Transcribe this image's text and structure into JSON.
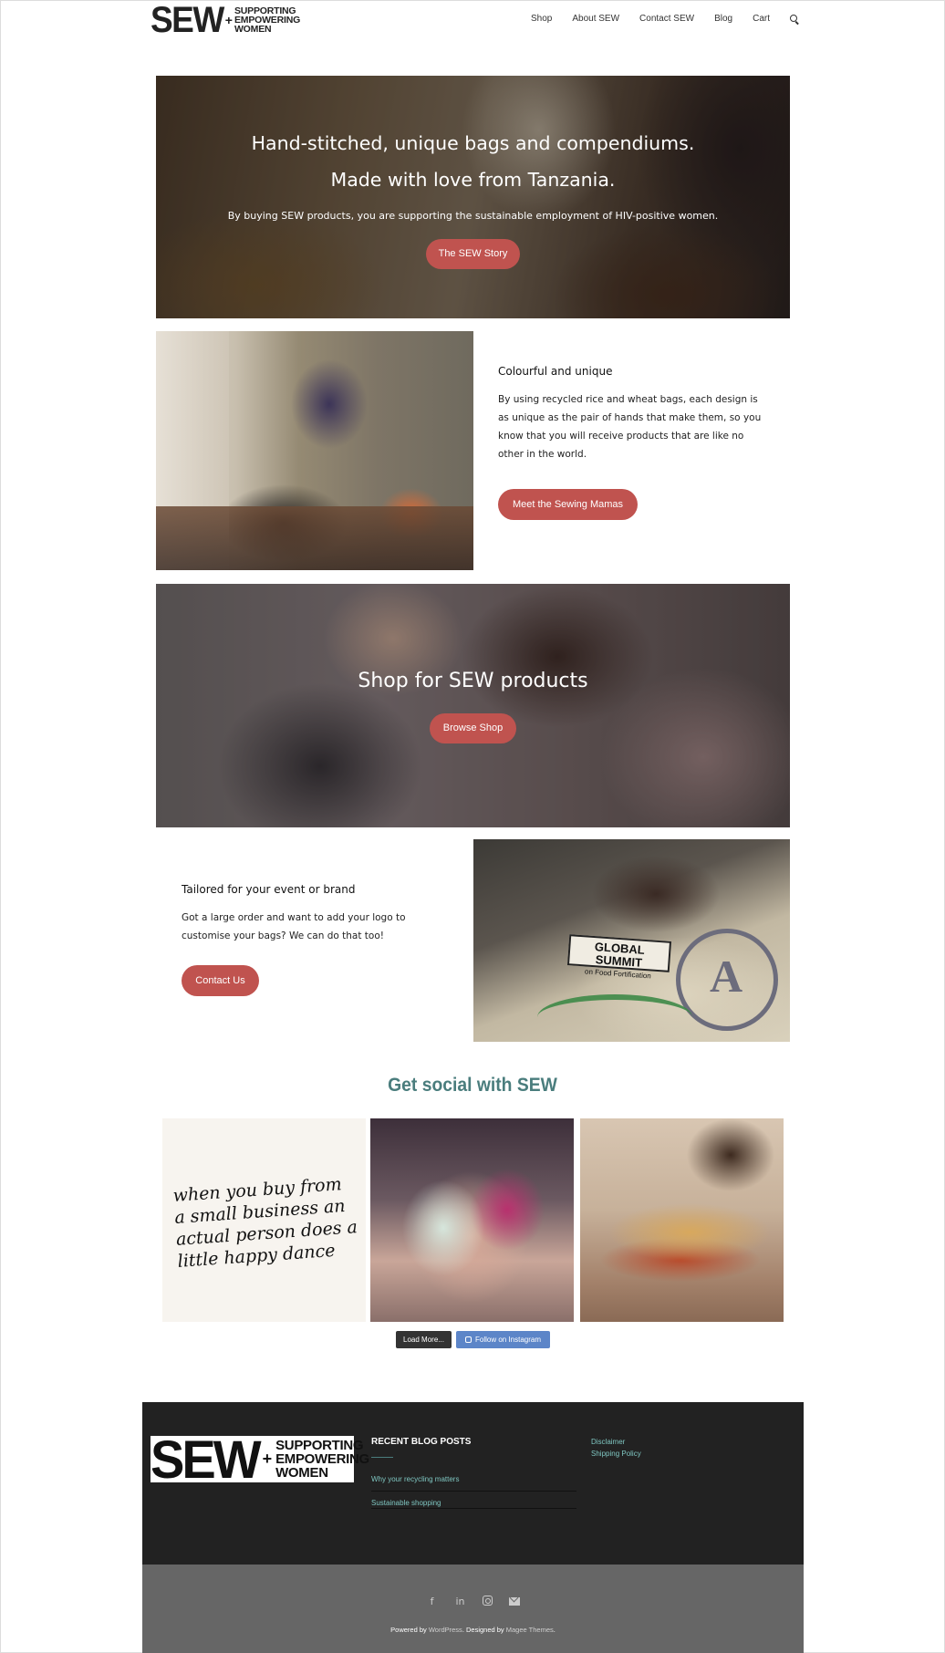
{
  "header": {
    "logo_mark": "SEW",
    "logo_plus": "+",
    "logo_words": [
      "SUPPORTING",
      "EMPOWERING",
      "WOMEN"
    ],
    "nav": [
      "Shop",
      "About SEW",
      "Contact SEW",
      "Blog",
      "Cart"
    ],
    "search_icon": "search-icon"
  },
  "hero": {
    "title_line1": "Hand-stitched, unique bags and compendiums.",
    "title_line2": "Made with love from Tanzania.",
    "subtitle": "By buying SEW products, you are supporting the sustainable employment of HIV-positive women.",
    "button": "The SEW Story"
  },
  "colourful": {
    "heading": "Colourful and unique",
    "body": "By using recycled rice and wheat bags, each design is as unique as the pair of hands that make them, so you know that you will receive products that are like no other in the world.",
    "button": "Meet the Sewing Mamas"
  },
  "shop_banner": {
    "title": "Shop for SEW products",
    "button": "Browse Shop"
  },
  "tailored": {
    "heading": "Tailored for your event or brand",
    "body": "Got a large order and want to add your logo to customise your bags? We can do that too!",
    "button": "Contact Us",
    "photo_label_line1": "GLOBAL SUMMIT",
    "photo_label_line2": "on Food Fortification"
  },
  "social": {
    "title": "Get social with SEW",
    "post1_text": "when you buy from a small business an actual person does a little happy dance",
    "load_more": "Load More...",
    "follow": "Follow on Instagram"
  },
  "footer": {
    "logo_mark": "SEW",
    "logo_plus": "+",
    "logo_words": [
      "SUPPORTING",
      "EMPOWERING",
      "WOMEN"
    ],
    "recent_title": "RECENT BLOG POSTS",
    "posts": [
      "Why your recycling matters",
      "Sustainable shopping"
    ],
    "links": [
      "Disclaimer",
      "Shipping Policy"
    ],
    "social_icons": [
      "facebook-icon",
      "linkedin-icon",
      "instagram-icon",
      "email-icon"
    ],
    "credits_prefix": "Powered by ",
    "credits_wp": "WordPress",
    "credits_mid": ". Designed by ",
    "credits_theme": "Magee Themes",
    "credits_suffix": "."
  },
  "colors": {
    "accent_button": "#c0534f",
    "social_title": "#4a7d7d",
    "footer_dark": "#222222",
    "footer_mid": "#666666",
    "footer_link": "#7fc6c1",
    "instagram_button": "#5c85c8"
  }
}
